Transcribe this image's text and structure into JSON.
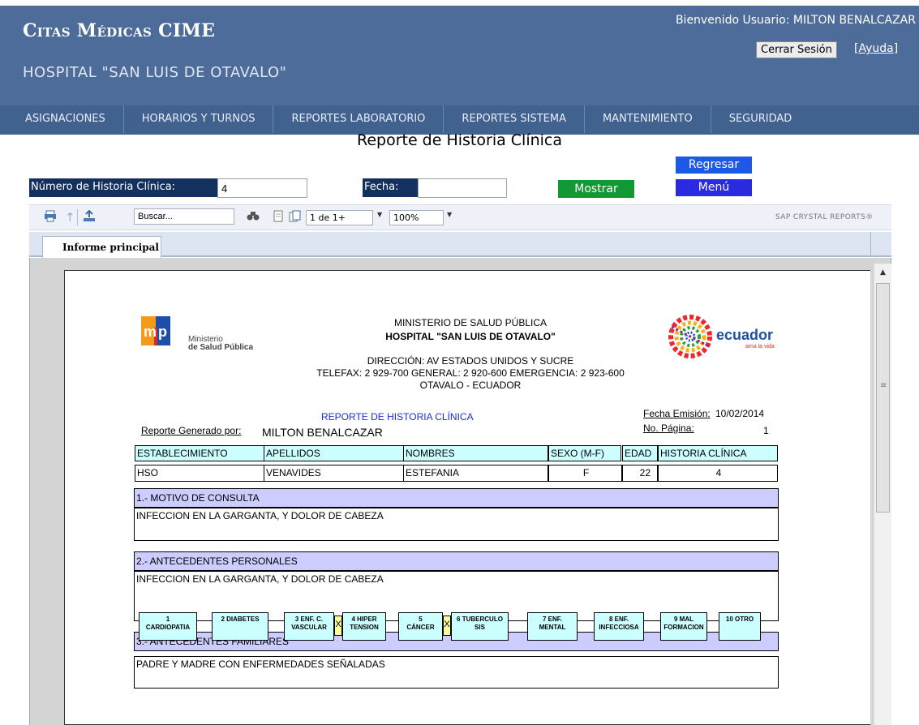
{
  "header": {
    "app_title": "Citas Médicas CIME",
    "hospital": "HOSPITAL \"SAN LUIS DE OTAVALO\"",
    "welcome": "Bienvenido Usuario: MILTON BENALCAZAR",
    "logout_label": "Cerrar Sesión",
    "help_label": "[Ayuda]"
  },
  "nav": {
    "items": [
      {
        "label": "ASIGNACIONES"
      },
      {
        "label": "HORARIOS Y TURNOS"
      },
      {
        "label": "REPORTES LABORATORIO"
      },
      {
        "label": "REPORTES SISTEMA"
      },
      {
        "label": "MANTENIMIENTO"
      },
      {
        "label": "SEGURIDAD"
      }
    ]
  },
  "page": {
    "title": "Reporte de Historia Clínica",
    "back_label": "Regresar",
    "menu_label": "Menú",
    "hc_label": "Número de Historia Clínica:",
    "hc_value": "4",
    "fecha_label": "Fecha:",
    "fecha_value": "",
    "show_label": "Mostrar"
  },
  "viewer": {
    "search_placeholder": "Buscar...",
    "page_indicator": "1 de 1+",
    "zoom": "100%",
    "brand": "SAP CRYSTAL REPORTS®",
    "tab_label": "Informe principal",
    "icons": [
      "print-icon",
      "export-icon",
      "up-icon",
      "search-binoculars-icon",
      "page-icon",
      "pages-icon"
    ]
  },
  "report": {
    "msp_name_1": "Ministerio",
    "msp_name_2": "de Salud Pública",
    "ecuador_brand": "ecuador",
    "ecuador_tagline": "ama la vida",
    "ministry": "MINISTERIO DE SALUD PÚBLICA",
    "hospital": "HOSPITAL \"SAN LUIS DE OTAVALO\"",
    "address": "DIRECCIÓN: AV ESTADOS UNIDOS Y SUCRE",
    "phones": "TELEFAX: 2 929-700    GENERAL: 2 920-600    EMERGENCIA: 2 923-600",
    "city": "OTAVALO - ECUADOR",
    "report_title": "REPORTE  DE HISTORIA CLÍNICA",
    "emission_label": "Fecha Emisión:",
    "emission_date": "10/02/2014",
    "page_label": "No. Página:",
    "page_number": "1",
    "generated_by_label": "Reporte Generado por:",
    "generated_by": "MILTON BENALCAZAR",
    "columns": [
      "ESTABLECIMIENTO",
      "APELLIDOS",
      "NOMBRES",
      "SEXO (M-F)",
      "EDAD",
      "HISTORIA CLÍNICA"
    ],
    "values": [
      "HSO",
      "VENAVIDES",
      "ESTEFANIA",
      "F",
      "22",
      "4"
    ],
    "section1_title": "1.- MOTIVO DE CONSULTA",
    "section1_text": "INFECCION EN LA GARGANTA, Y DOLOR DE CABEZA",
    "section2_title": "2.- ANTECEDENTES PERSONALES",
    "section2_text": "INFECCION EN LA GARGANTA, Y DOLOR DE CABEZA",
    "section3_title": "3.- ANTECEDENTES FAMILIARES",
    "family_items": [
      {
        "l1": "1",
        "l2": "CARDIOPATIA"
      },
      {
        "l1": "2 DIABETES",
        "l2": ""
      },
      {
        "l1": "3 ENF. C.",
        "l2": "VASCULAR"
      },
      {
        "l1": "4 HIPER",
        "l2": "TENSION"
      },
      {
        "l1": "5",
        "l2": "CÁNCER"
      },
      {
        "l1": "6 TUBERCULO",
        "l2": "SIS"
      },
      {
        "l1": "7 ENF.",
        "l2": "MENTAL"
      },
      {
        "l1": "8 ENF.",
        "l2": "INFECCIOSA"
      },
      {
        "l1": "9 MAL",
        "l2": "FORMACION"
      },
      {
        "l1": "10 OTRO",
        "l2": ""
      }
    ],
    "family_marks": [
      "X",
      "X"
    ],
    "section3_text": "PADRE Y MADRE CON ENFERMEDADES SEÑALADAS"
  }
}
